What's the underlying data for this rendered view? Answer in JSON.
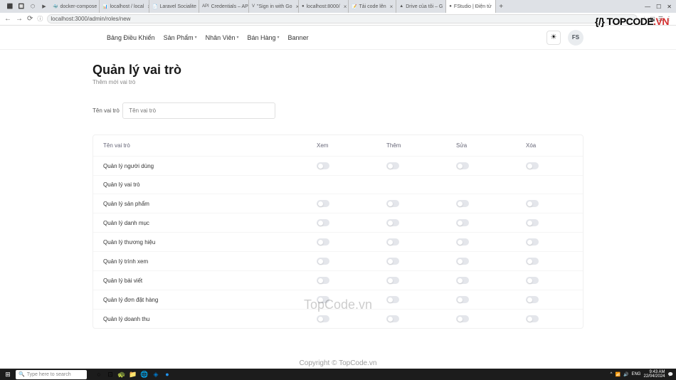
{
  "browser": {
    "tabs": [
      {
        "icon": "⬛",
        "label": ""
      },
      {
        "icon": "🔲",
        "label": ""
      },
      {
        "icon": "⬡",
        "label": ""
      },
      {
        "icon": "▶",
        "label": ""
      },
      {
        "icon": "🐳",
        "label": "docker-compose"
      },
      {
        "icon": "📊",
        "label": "localhost / local"
      },
      {
        "icon": "📄",
        "label": "Laravel Socialite"
      },
      {
        "icon": "API",
        "label": "Credentials – AP"
      },
      {
        "icon": "V",
        "label": "\"Sign in with Go"
      },
      {
        "icon": "●",
        "label": "localhost:8000/"
      },
      {
        "icon": "📝",
        "label": "Tải code lên"
      },
      {
        "icon": "▲",
        "label": "Drive của tôi – G"
      },
      {
        "icon": "●",
        "label": "FStudio | Điện tử",
        "active": true
      }
    ],
    "url": "localhost:3000/admin/roles/new",
    "win_controls": {
      "min": "—",
      "max": "☐",
      "close": "✕"
    }
  },
  "watermarks": {
    "top": "{/} TOPCODE.VN",
    "center": "TopCode.vn",
    "bottom": "Copyright © TopCode.vn"
  },
  "nav": {
    "dashboard": "Bảng Điều Khiển",
    "products": "Sản Phẩm",
    "staff": "Nhân Viên",
    "sales": "Bán Hàng",
    "banner": "Banner"
  },
  "user_initials": "FS",
  "page": {
    "title": "Quản lý vai trò",
    "subtitle": "Thêm mới vai trò"
  },
  "form": {
    "role_name_label": "Tên vai trò",
    "role_name_placeholder": "Tên vai trò"
  },
  "table": {
    "headers": {
      "name": "Tên vai trò",
      "view": "Xem",
      "add": "Thêm",
      "edit": "Sửa",
      "delete": "Xóa"
    },
    "rows": [
      {
        "name": "Quản lý người dùng"
      },
      {
        "name": "Quản lý vai trò",
        "no_toggles": true
      },
      {
        "name": "Quản lý sản phẩm"
      },
      {
        "name": "Quản lý danh mục"
      },
      {
        "name": "Quản lý thương hiệu"
      },
      {
        "name": "Quản lý trình xem"
      },
      {
        "name": "Quản lý bài viết"
      },
      {
        "name": "Quản lý đơn đặt hàng"
      },
      {
        "name": "Quản lý doanh thu"
      }
    ]
  },
  "taskbar": {
    "search_placeholder": "Type here to search",
    "time": "9:43 AM",
    "date": "22/04/2024"
  }
}
